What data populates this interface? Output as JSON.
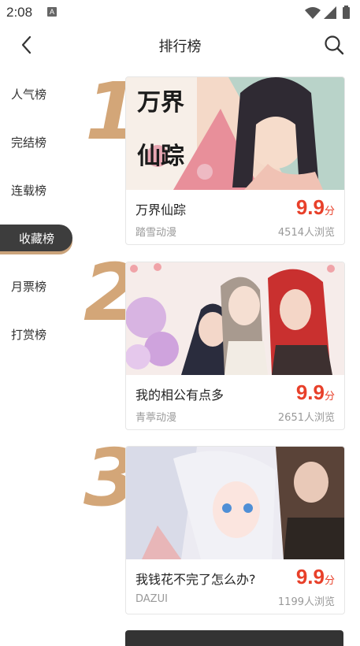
{
  "status": {
    "time": "2:08",
    "a_badge": "A"
  },
  "header": {
    "title": "排行榜"
  },
  "sidebar": {
    "items": [
      {
        "label": "人气榜"
      },
      {
        "label": "完结榜"
      },
      {
        "label": "连载榜"
      },
      {
        "label": "收藏榜",
        "active": true
      },
      {
        "label": "月票榜"
      },
      {
        "label": "打赏榜"
      }
    ]
  },
  "ranking": [
    {
      "rank": "1",
      "title": "万界仙踪",
      "score": "9.9",
      "score_unit": "分",
      "author": "踏雪动漫",
      "views": "4514人浏览",
      "cover_text": "万界仙踪"
    },
    {
      "rank": "2",
      "title": "我的相公有点多",
      "score": "9.9",
      "score_unit": "分",
      "author": "青葶动漫",
      "views": "2651人浏览"
    },
    {
      "rank": "3",
      "title": "我钱花不完了怎么办?",
      "score": "9.9",
      "score_unit": "分",
      "author": "DAZUI",
      "views": "1199人浏览"
    }
  ],
  "colors": {
    "accent": "#e8402a",
    "rank": "#d3a678",
    "active_bg": "#3d3d3d"
  }
}
